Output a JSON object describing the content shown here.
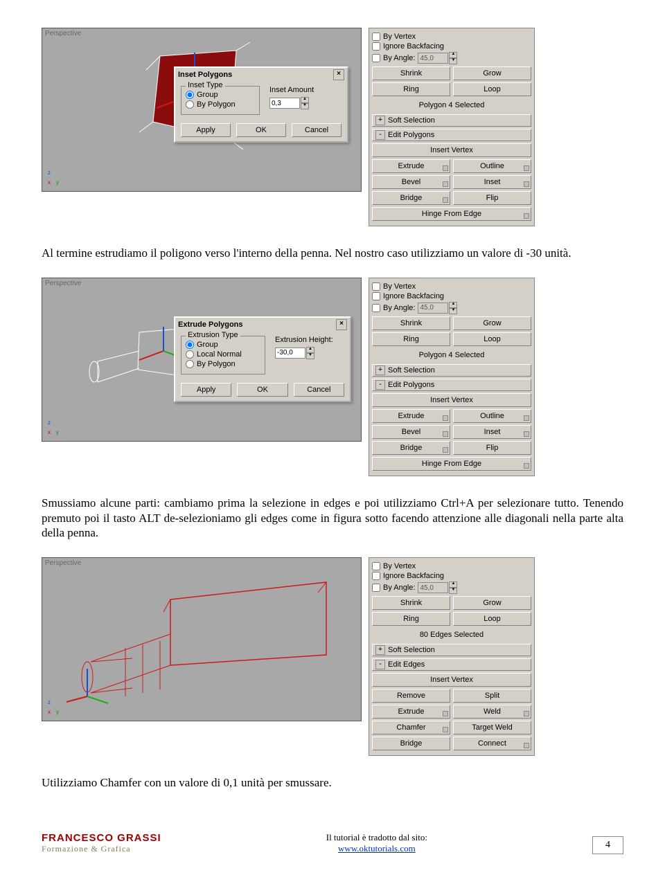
{
  "panel1": {
    "byVertex": "By Vertex",
    "ignoreBackfacing": "Ignore Backfacing",
    "byAngle": "By Angle:",
    "angleVal": "45,0",
    "shrink": "Shrink",
    "grow": "Grow",
    "ring": "Ring",
    "loop": "Loop",
    "softSelection": "Soft Selection",
    "editPolygons": "Edit Polygons",
    "insertVertex": "Insert Vertex",
    "extrude": "Extrude",
    "outline": "Outline",
    "bevel": "Bevel",
    "inset": "Inset",
    "bridge": "Bridge",
    "flip": "Flip",
    "hinge": "Hinge From Edge",
    "sel1": "Polygon 4 Selected",
    "editEdges": "Edit Edges",
    "remove": "Remove",
    "split": "Split",
    "weld": "Weld",
    "chamfer": "Chamfer",
    "targetWeld": "Target Weld",
    "connect": "Connect",
    "sel3": "80 Edges Selected"
  },
  "dialog1": {
    "title": "Inset Polygons",
    "typeLegend": "Inset Type",
    "group": "Group",
    "byPoly": "By Polygon",
    "amountLabel": "Inset Amount",
    "amountVal": "0,3",
    "apply": "Apply",
    "ok": "OK",
    "cancel": "Cancel"
  },
  "dialog2": {
    "title": "Extrude Polygons",
    "typeLegend": "Extrusion Type",
    "group": "Group",
    "localNormal": "Local Normal",
    "byPoly": "By Polygon",
    "heightLabel": "Extrusion Height:",
    "heightVal": "-30,0",
    "apply": "Apply",
    "ok": "OK",
    "cancel": "Cancel"
  },
  "viewport": {
    "label": "Perspective"
  },
  "text": {
    "p1": "Al termine estrudiamo il poligono verso l'interno della penna. Nel nostro caso utilizziamo un valore di -30 unità.",
    "p2": "Smussiamo alcune parti: cambiamo prima la selezione in edges e poi utilizziamo Ctrl+A per selezionare tutto. Tenendo premuto poi il tasto ALT de-selezioniamo gli edges come in figura sotto facendo attenzione alle diagonali nella parte alta della penna.",
    "p3": "Utilizziamo Chamfer con un valore di 0,1 unità per smussare."
  },
  "footer": {
    "brand": "FRANCESCO GRASSI",
    "brandSub": "Formazione & Grafica",
    "credit": "Il tutorial è tradotto dal sito:",
    "url": "www.oktutorials.com",
    "page": "4"
  }
}
